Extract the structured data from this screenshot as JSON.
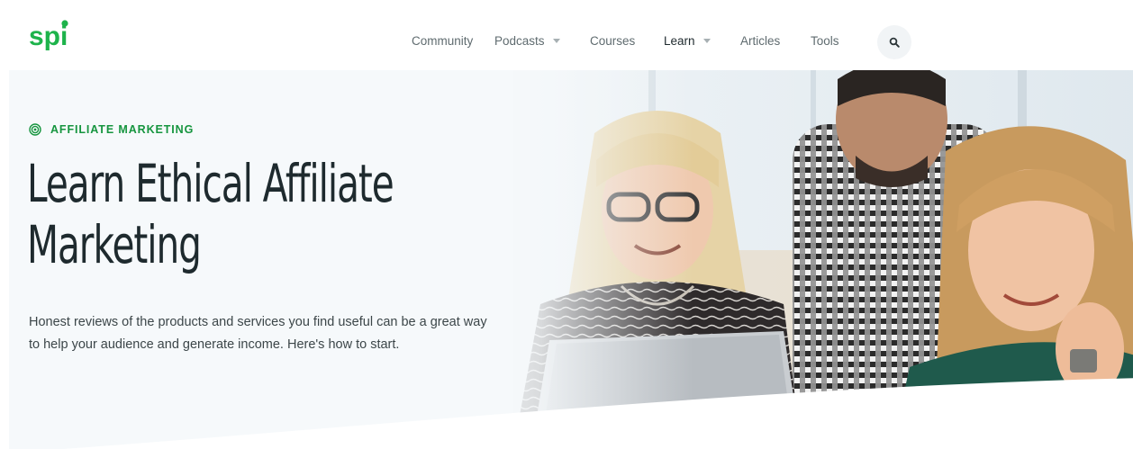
{
  "header": {
    "logo_text": "spi",
    "nav": [
      {
        "label": "Community"
      },
      {
        "label": "Podcasts",
        "dropdown": true
      },
      {
        "label": "Courses"
      },
      {
        "label": "Learn",
        "dropdown": true,
        "active": true
      },
      {
        "label": "Articles"
      },
      {
        "label": "Tools"
      }
    ],
    "search_icon": "search-icon"
  },
  "hero": {
    "eyebrow_icon": "target-icon",
    "eyebrow": "AFFILIATE MARKETING",
    "title_line1": "Learn Ethical Affiliate",
    "title_line2": "Marketing",
    "subtitle": "Honest reviews of the products and services you find useful can be a great way to help your audience and generate income. Here's how to start."
  },
  "colors": {
    "brand_green": "#16953f",
    "logo_green": "#1db34b",
    "text_dark": "#1e2a2e",
    "nav_text": "#5f6b6f",
    "hero_bg": "#f6f9fb"
  }
}
